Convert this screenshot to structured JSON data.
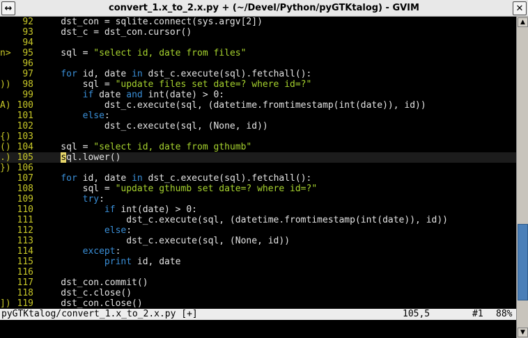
{
  "window": {
    "title": "convert_1.x_to_2.x.py + (~/Devel/Python/pyGTKtalog) - GVIM",
    "menu_icon": "window-menu-icon",
    "close_icon": "close-icon",
    "left_button_glyph": "↔",
    "close_glyph": "✕"
  },
  "editor": {
    "colors": {
      "background": "#000000",
      "line_number": "#c8c828",
      "keyword": "#3a8fd8",
      "string": "#a6d22e",
      "cursor": "#e6d66a"
    },
    "cursor_line": 105,
    "lines": [
      {
        "n": "92",
        "sign": "",
        "segs": [
          [
            "",
            "    dst_con = sqlite.connect(sys.argv[2])"
          ]
        ]
      },
      {
        "n": "93",
        "sign": "",
        "segs": [
          [
            "",
            "    dst_c = dst_con.cursor()"
          ]
        ]
      },
      {
        "n": "94",
        "sign": "",
        "segs": []
      },
      {
        "n": "95",
        "sign": "n>",
        "segs": [
          [
            "",
            "    sql = "
          ],
          [
            "str",
            "\"select id, date from files\""
          ]
        ]
      },
      {
        "n": "96",
        "sign": "",
        "segs": []
      },
      {
        "n": "97",
        "sign": "",
        "segs": [
          [
            "kw",
            "    for"
          ],
          [
            "",
            " id, date "
          ],
          [
            "kw",
            "in"
          ],
          [
            "",
            " dst_c.execute(sql).fetchall():"
          ]
        ]
      },
      {
        "n": "98",
        "sign": "))",
        "segs": [
          [
            "",
            "        sql = "
          ],
          [
            "str",
            "\"update files set date=? where id=?\""
          ]
        ]
      },
      {
        "n": "99",
        "sign": "",
        "segs": [
          [
            "kw",
            "        if"
          ],
          [
            "",
            " date "
          ],
          [
            "kw",
            "and"
          ],
          [
            "",
            " int(date) > 0:"
          ]
        ]
      },
      {
        "n": "100",
        "sign": "A)",
        "segs": [
          [
            "",
            "            dst_c.execute(sql, (datetime.fromtimestamp(int(date)), id))"
          ]
        ]
      },
      {
        "n": "101",
        "sign": "",
        "segs": [
          [
            "kw",
            "        else"
          ],
          [
            "",
            ":"
          ]
        ]
      },
      {
        "n": "102",
        "sign": "",
        "segs": [
          [
            "",
            "            dst_c.execute(sql, (None, id))"
          ]
        ]
      },
      {
        "n": "103",
        "sign": "{)",
        "segs": []
      },
      {
        "n": "104",
        "sign": "()",
        "segs": [
          [
            "",
            "    sql = "
          ],
          [
            "str",
            "\"select id, date from gthumb\""
          ]
        ]
      },
      {
        "n": "105",
        "sign": ".)",
        "segs": [
          [
            "",
            "    "
          ],
          [
            "cur",
            "s"
          ],
          [
            "",
            "ql.lower()"
          ]
        ]
      },
      {
        "n": "106",
        "sign": "})",
        "segs": []
      },
      {
        "n": "107",
        "sign": "",
        "segs": [
          [
            "kw",
            "    for"
          ],
          [
            "",
            " id, date "
          ],
          [
            "kw",
            "in"
          ],
          [
            "",
            " dst_c.execute(sql).fetchall():"
          ]
        ]
      },
      {
        "n": "108",
        "sign": "",
        "segs": [
          [
            "",
            "        sql = "
          ],
          [
            "str",
            "\"update gthumb set date=? where id=?\""
          ]
        ]
      },
      {
        "n": "109",
        "sign": "",
        "segs": [
          [
            "kw",
            "        try"
          ],
          [
            "",
            ":"
          ]
        ]
      },
      {
        "n": "110",
        "sign": "",
        "segs": [
          [
            "kw",
            "            if"
          ],
          [
            "",
            " int(date) > 0:"
          ]
        ]
      },
      {
        "n": "111",
        "sign": "",
        "segs": [
          [
            "",
            "                dst_c.execute(sql, (datetime.fromtimestamp(int(date)), id))"
          ]
        ]
      },
      {
        "n": "112",
        "sign": "",
        "segs": [
          [
            "kw",
            "            else"
          ],
          [
            "",
            ":"
          ]
        ]
      },
      {
        "n": "113",
        "sign": "",
        "segs": [
          [
            "",
            "                dst_c.execute(sql, (None, id))"
          ]
        ]
      },
      {
        "n": "114",
        "sign": "",
        "segs": [
          [
            "kw",
            "        except"
          ],
          [
            "",
            ":"
          ]
        ]
      },
      {
        "n": "115",
        "sign": "",
        "segs": [
          [
            "kw",
            "            print"
          ],
          [
            "",
            " id, date"
          ]
        ]
      },
      {
        "n": "116",
        "sign": "",
        "segs": []
      },
      {
        "n": "117",
        "sign": "",
        "segs": [
          [
            "",
            "    dst_con.commit()"
          ]
        ]
      },
      {
        "n": "118",
        "sign": "",
        "segs": [
          [
            "",
            "    dst_c.close()"
          ]
        ]
      },
      {
        "n": "119",
        "sign": "])",
        "segs": [
          [
            "",
            "    dst_con.close()"
          ]
        ]
      }
    ]
  },
  "statusline": {
    "file": "pyGTKtalog/convert_1.x_to_2.x.py [+]",
    "position": "105,5",
    "buffer": "#1",
    "percent": "88%"
  },
  "scrollbar": {
    "position_fraction": 0.88,
    "up_glyph": "▲",
    "down_glyph": "▼"
  }
}
